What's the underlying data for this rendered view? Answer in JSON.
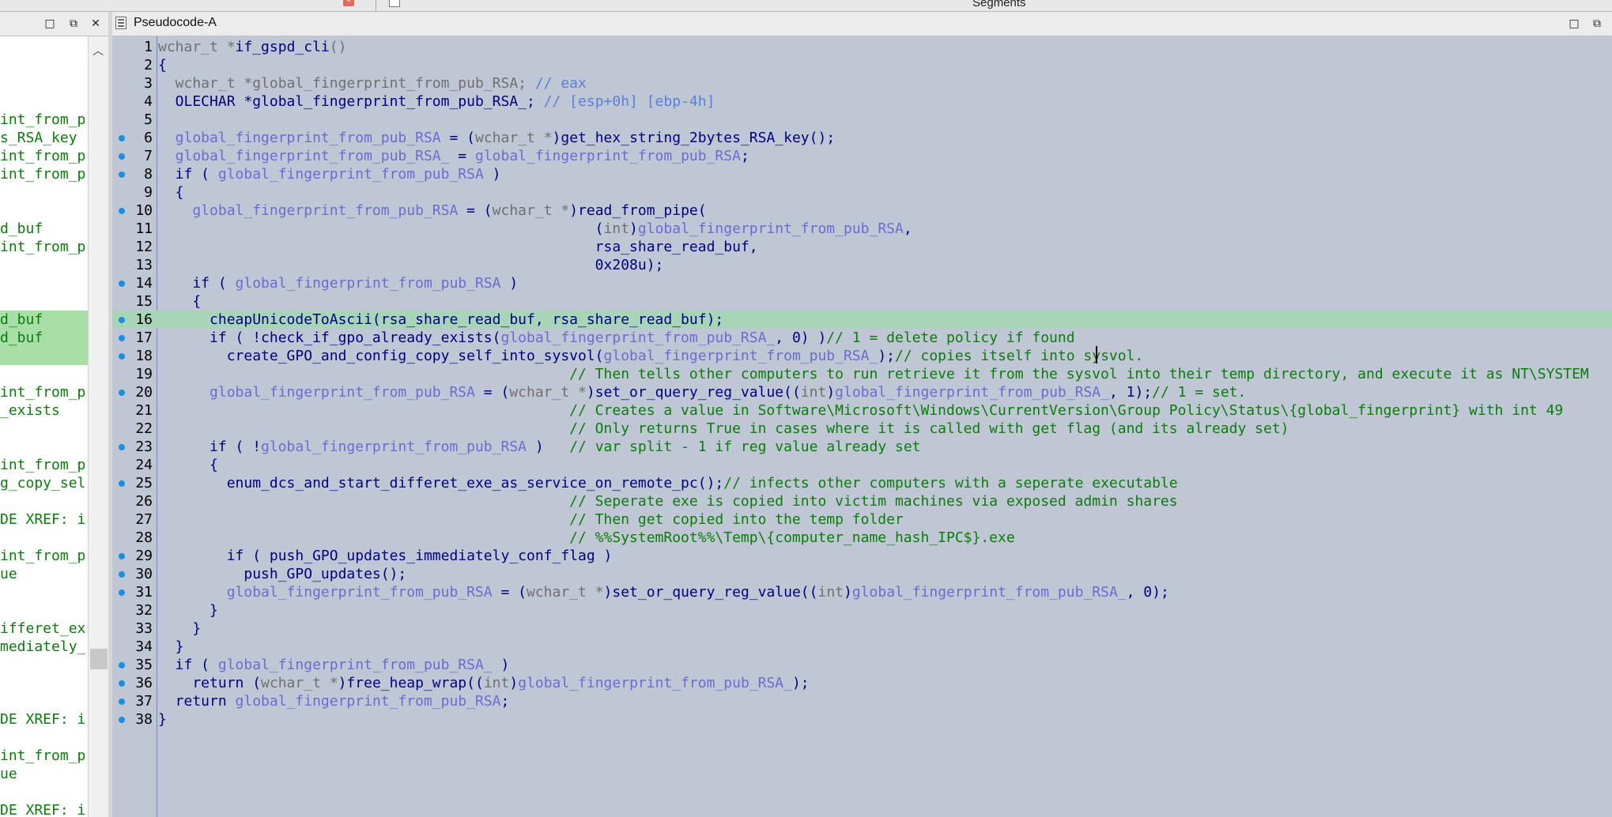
{
  "top": {
    "segments_title": "Segments"
  },
  "left_header": {
    "minimize": "□",
    "restore": "⧉",
    "close": "✕"
  },
  "main_header": {
    "tab_title": "Pseudocode-A",
    "minimize": "□",
    "restore": "⧉"
  },
  "left_pane": {
    "lines": [
      {
        "row": 4,
        "text": "int_from_p",
        "hl": false
      },
      {
        "row": 5,
        "text": "s_RSA_key",
        "hl": false
      },
      {
        "row": 6,
        "text": "int_from_p",
        "hl": false
      },
      {
        "row": 7,
        "text": "int_from_p",
        "hl": false
      },
      {
        "row": 10,
        "text": "d_buf",
        "hl": false
      },
      {
        "row": 11,
        "text": "int_from_p",
        "hl": false
      },
      {
        "row": 15,
        "text": "d_buf",
        "hl": true
      },
      {
        "row": 16,
        "text": "d_buf",
        "hl": true
      },
      {
        "row": 17,
        "text": "",
        "hl": true
      },
      {
        "row": 19,
        "text": "int_from_p",
        "hl": false
      },
      {
        "row": 20,
        "text": "_exists",
        "hl": false
      },
      {
        "row": 23,
        "text": "int_from_p",
        "hl": false
      },
      {
        "row": 24,
        "text": "g_copy_sel",
        "hl": false
      },
      {
        "row": 26,
        "text": "DE XREF: i",
        "hl": false
      },
      {
        "row": 28,
        "text": "int_from_p",
        "hl": false
      },
      {
        "row": 29,
        "text": "ue",
        "hl": false
      },
      {
        "row": 32,
        "text": "ifferet_ex",
        "hl": false
      },
      {
        "row": 33,
        "text": "mediately_",
        "hl": false
      },
      {
        "row": 37,
        "text": "DE XREF: i",
        "hl": false
      },
      {
        "row": 39,
        "text": "int_from_p",
        "hl": false
      },
      {
        "row": 40,
        "text": "ue",
        "hl": false
      },
      {
        "row": 42,
        "text": "DE XREF: i",
        "hl": false
      }
    ]
  },
  "code": {
    "current_line": 16,
    "lines": [
      {
        "n": "1",
        "bp": false,
        "segs": [
          [
            "c-type",
            "wchar_t *"
          ],
          [
            "c-plain",
            "if_gspd_cli"
          ],
          [
            "c-type",
            "()"
          ]
        ]
      },
      {
        "n": "2",
        "bp": false,
        "segs": [
          [
            "c-plain",
            "{"
          ]
        ]
      },
      {
        "n": "3",
        "bp": false,
        "segs": [
          [
            "c-type",
            "  wchar_t *global_fingerprint_from_pub_RSA; "
          ],
          [
            "c-cmtb",
            "// eax"
          ]
        ]
      },
      {
        "n": "4",
        "bp": false,
        "segs": [
          [
            "c-plain",
            "  OLECHAR *global_fingerprint_from_pub_RSA_; "
          ],
          [
            "c-cmtb",
            "// [esp+0h] [ebp-4h]"
          ]
        ]
      },
      {
        "n": "5",
        "bp": false,
        "segs": []
      },
      {
        "n": "6",
        "bp": true,
        "segs": [
          [
            "c-var",
            "  global_fingerprint_from_pub_RSA"
          ],
          [
            "c-plain",
            " = ("
          ],
          [
            "c-type",
            "wchar_t *"
          ],
          [
            "c-plain",
            ")get_hex_string_2bytes_RSA_key();"
          ]
        ]
      },
      {
        "n": "7",
        "bp": true,
        "segs": [
          [
            "c-var",
            "  global_fingerprint_from_pub_RSA_"
          ],
          [
            "c-plain",
            " = "
          ],
          [
            "c-var",
            "global_fingerprint_from_pub_RSA"
          ],
          [
            "c-plain",
            ";"
          ]
        ]
      },
      {
        "n": "8",
        "bp": true,
        "segs": [
          [
            "c-plain",
            "  if ( "
          ],
          [
            "c-var",
            "global_fingerprint_from_pub_RSA"
          ],
          [
            "c-plain",
            " )"
          ]
        ]
      },
      {
        "n": "9",
        "bp": false,
        "segs": [
          [
            "c-plain",
            "  {"
          ]
        ]
      },
      {
        "n": "10",
        "bp": true,
        "segs": [
          [
            "c-var",
            "    global_fingerprint_from_pub_RSA"
          ],
          [
            "c-plain",
            " = ("
          ],
          [
            "c-type",
            "wchar_t *"
          ],
          [
            "c-plain",
            ")read_from_pipe("
          ]
        ]
      },
      {
        "n": "11",
        "bp": false,
        "segs": [
          [
            "c-plain",
            "                                                   ("
          ],
          [
            "c-type",
            "int"
          ],
          [
            "c-plain",
            ")"
          ],
          [
            "c-var",
            "global_fingerprint_from_pub_RSA"
          ],
          [
            "c-plain",
            ","
          ]
        ]
      },
      {
        "n": "12",
        "bp": false,
        "segs": [
          [
            "c-plain",
            "                                                   rsa_share_read_buf,"
          ]
        ]
      },
      {
        "n": "13",
        "bp": false,
        "segs": [
          [
            "c-plain",
            "                                                   0x208u);"
          ]
        ]
      },
      {
        "n": "14",
        "bp": true,
        "segs": [
          [
            "c-plain",
            "    if ( "
          ],
          [
            "c-var",
            "global_fingerprint_from_pub_RSA"
          ],
          [
            "c-plain",
            " )"
          ]
        ]
      },
      {
        "n": "15",
        "bp": false,
        "segs": [
          [
            "c-plain",
            "    {"
          ]
        ]
      },
      {
        "n": "16",
        "bp": true,
        "segs": [
          [
            "c-plain",
            "      cheapUnicodeToAscii(rsa_share_read_buf, rsa_share_read_buf);"
          ]
        ]
      },
      {
        "n": "17",
        "bp": true,
        "segs": [
          [
            "c-plain",
            "      if ( !check_if_gpo_already_exists("
          ],
          [
            "c-var",
            "global_fingerprint_from_pub_RSA_"
          ],
          [
            "c-plain",
            ", 0) )"
          ],
          [
            "c-cmt",
            "// 1 = delete policy if found"
          ]
        ]
      },
      {
        "n": "18",
        "bp": true,
        "segs": [
          [
            "c-plain",
            "        create_GPO_and_config_copy_self_into_sysvol("
          ],
          [
            "c-var",
            "global_fingerprint_from_pub_RSA_"
          ],
          [
            "c-plain",
            ");"
          ],
          [
            "c-cmt",
            "// copies itself into sysvol."
          ]
        ]
      },
      {
        "n": "19",
        "bp": false,
        "segs": [
          [
            "c-cmt",
            "                                                // Then tells other computers to run retrieve it from the sysvol into their temp directory, and execute it as NT\\SYSTEM"
          ]
        ]
      },
      {
        "n": "20",
        "bp": true,
        "segs": [
          [
            "c-var",
            "      global_fingerprint_from_pub_RSA"
          ],
          [
            "c-plain",
            " = ("
          ],
          [
            "c-type",
            "wchar_t *"
          ],
          [
            "c-plain",
            ")set_or_query_reg_value(("
          ],
          [
            "c-type",
            "int"
          ],
          [
            "c-plain",
            ")"
          ],
          [
            "c-var",
            "global_fingerprint_from_pub_RSA_"
          ],
          [
            "c-plain",
            ", 1);"
          ],
          [
            "c-cmt",
            "// 1 = set."
          ]
        ]
      },
      {
        "n": "21",
        "bp": false,
        "segs": [
          [
            "c-cmt",
            "                                                // Creates a value in Software\\Microsoft\\Windows\\CurrentVersion\\Group Policy\\Status\\{global_fingerprint} with int 49"
          ]
        ]
      },
      {
        "n": "22",
        "bp": false,
        "segs": [
          [
            "c-cmt",
            "                                                // Only returns True in cases where it is called with get flag (and its already set)"
          ]
        ]
      },
      {
        "n": "23",
        "bp": true,
        "segs": [
          [
            "c-plain",
            "      if ( !"
          ],
          [
            "c-var",
            "global_fingerprint_from_pub_RSA"
          ],
          [
            "c-plain",
            " )   "
          ],
          [
            "c-cmt",
            "// var split - 1 if reg value already set"
          ]
        ]
      },
      {
        "n": "24",
        "bp": false,
        "segs": [
          [
            "c-plain",
            "      {"
          ]
        ]
      },
      {
        "n": "25",
        "bp": true,
        "segs": [
          [
            "c-plain",
            "        enum_dcs_and_start_differet_exe_as_service_on_remote_pc();"
          ],
          [
            "c-cmt",
            "// infects other computers with a seperate executable"
          ]
        ]
      },
      {
        "n": "26",
        "bp": false,
        "segs": [
          [
            "c-cmt",
            "                                                // Seperate exe is copied into victim machines via exposed admin shares"
          ]
        ]
      },
      {
        "n": "27",
        "bp": false,
        "segs": [
          [
            "c-cmt",
            "                                                // Then get copied into the temp folder"
          ]
        ]
      },
      {
        "n": "28",
        "bp": false,
        "segs": [
          [
            "c-cmt",
            "                                                // %%SystemRoot%%\\Temp\\{computer_name_hash_IPC$}.exe"
          ]
        ]
      },
      {
        "n": "29",
        "bp": true,
        "segs": [
          [
            "c-plain",
            "        if ( push_GPO_updates_immediately_conf_flag )"
          ]
        ]
      },
      {
        "n": "30",
        "bp": true,
        "segs": [
          [
            "c-plain",
            "          push_GPO_updates();"
          ]
        ]
      },
      {
        "n": "31",
        "bp": true,
        "segs": [
          [
            "c-var",
            "        global_fingerprint_from_pub_RSA"
          ],
          [
            "c-plain",
            " = ("
          ],
          [
            "c-type",
            "wchar_t *"
          ],
          [
            "c-plain",
            ")set_or_query_reg_value(("
          ],
          [
            "c-type",
            "int"
          ],
          [
            "c-plain",
            ")"
          ],
          [
            "c-var",
            "global_fingerprint_from_pub_RSA_"
          ],
          [
            "c-plain",
            ", 0);"
          ]
        ]
      },
      {
        "n": "32",
        "bp": false,
        "segs": [
          [
            "c-plain",
            "      }"
          ]
        ]
      },
      {
        "n": "33",
        "bp": false,
        "segs": [
          [
            "c-plain",
            "    }"
          ]
        ]
      },
      {
        "n": "34",
        "bp": false,
        "segs": [
          [
            "c-plain",
            "  }"
          ]
        ]
      },
      {
        "n": "35",
        "bp": true,
        "segs": [
          [
            "c-plain",
            "  if ( "
          ],
          [
            "c-var",
            "global_fingerprint_from_pub_RSA_"
          ],
          [
            "c-plain",
            " )"
          ]
        ]
      },
      {
        "n": "36",
        "bp": true,
        "segs": [
          [
            "c-plain",
            "    return ("
          ],
          [
            "c-type",
            "wchar_t *"
          ],
          [
            "c-plain",
            ")free_heap_wrap(("
          ],
          [
            "c-type",
            "int"
          ],
          [
            "c-plain",
            ")"
          ],
          [
            "c-var",
            "global_fingerprint_from_pub_RSA_"
          ],
          [
            "c-plain",
            ");"
          ]
        ]
      },
      {
        "n": "37",
        "bp": true,
        "segs": [
          [
            "c-plain",
            "  return "
          ],
          [
            "c-var",
            "global_fingerprint_from_pub_RSA"
          ],
          [
            "c-plain",
            ";"
          ]
        ]
      },
      {
        "n": "38",
        "bp": true,
        "segs": [
          [
            "c-plain",
            "}"
          ]
        ]
      }
    ]
  }
}
